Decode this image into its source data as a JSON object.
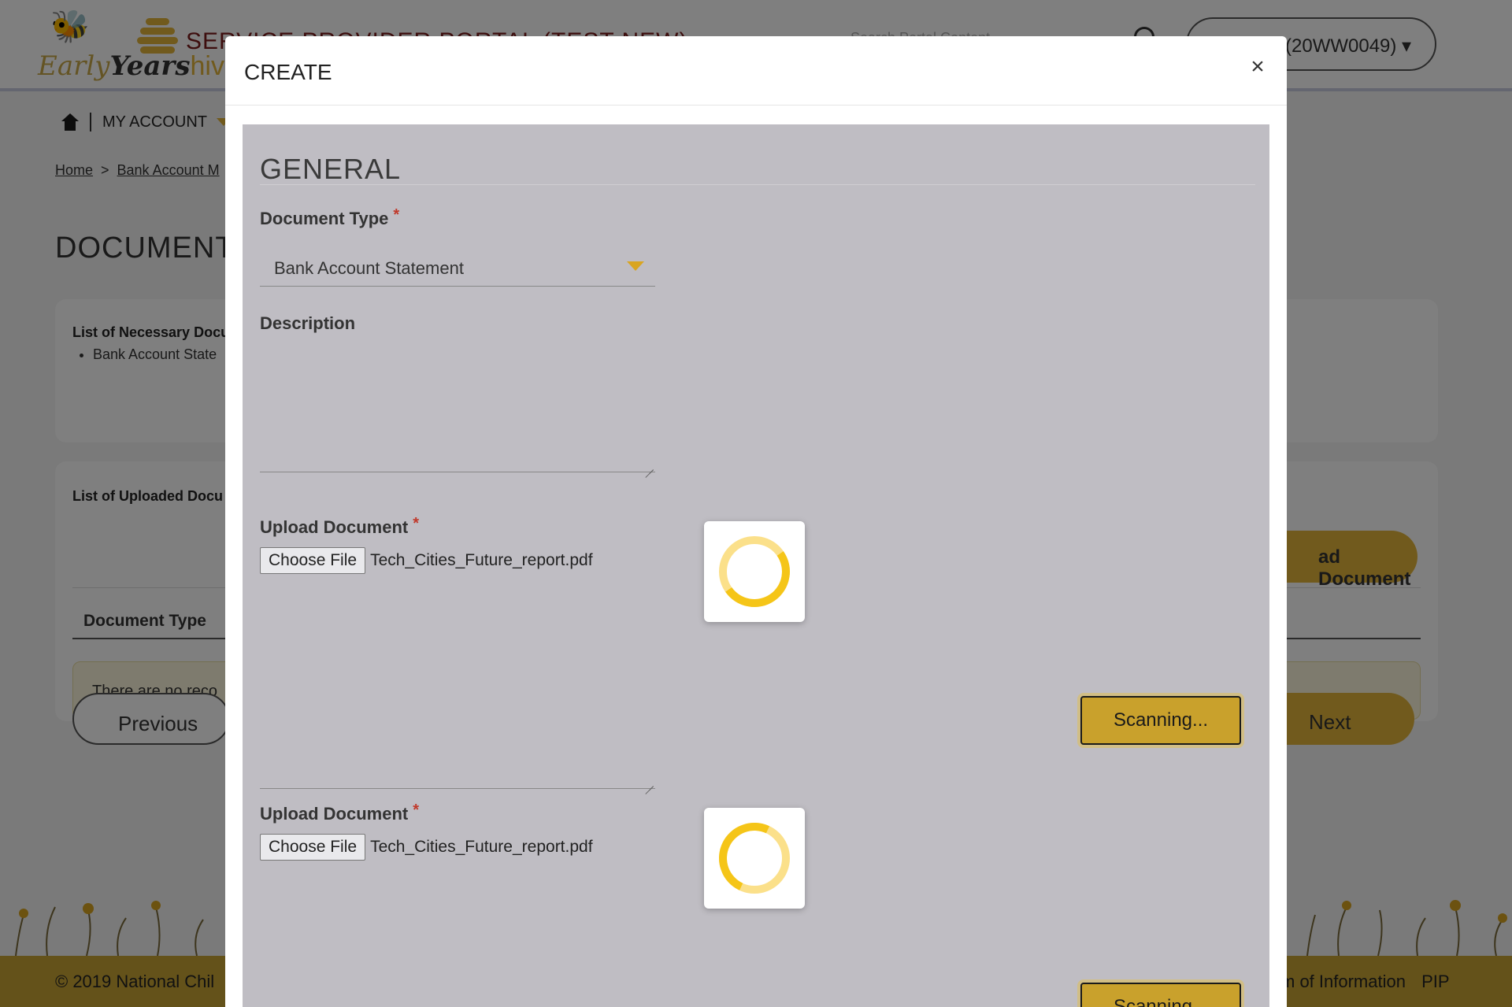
{
  "header": {
    "logo_text": [
      "Early",
      "Years",
      "hive"
    ],
    "portal_title": "SERVICE PROVIDER PORTAL (TEST NEW)",
    "search_placeholder": "Search Portal Content",
    "account_label": "(20WW0049)"
  },
  "nav": {
    "my_account": "MY ACCOUNT"
  },
  "breadcrumb": {
    "home": "Home",
    "separator": ">",
    "current": "Bank Account M"
  },
  "page": {
    "title": "DOCUMENT",
    "necessary_title": "List of Necessary Docu",
    "necessary_items": [
      "Bank Account State"
    ],
    "uploaded_title": "List of Uploaded Docu",
    "add_document": "ad Document",
    "col_document_type": "Document Type",
    "no_records": "There are no reco",
    "previous": "Previous",
    "next": "Next"
  },
  "footer": {
    "copyright": "© 2019 National Chil",
    "links": [
      "m of Information",
      "PIP"
    ]
  },
  "modal": {
    "title": "CREATE",
    "close": "×",
    "section_title": "GENERAL",
    "document_type_label": "Document Type",
    "document_type_value": "Bank Account Statement",
    "description_label": "Description",
    "required_mark": "*",
    "uploads": [
      {
        "label": "Upload Document",
        "button": "Choose File",
        "file_name": "Tech_Cities_Future_report.pdf",
        "scan_label": "Scanning..."
      },
      {
        "label": "Upload Document",
        "button": "Choose File",
        "file_name": "Tech_Cities_Future_report.pdf",
        "scan_label": "Scanning..."
      }
    ]
  },
  "colors": {
    "accent": "#e2b43a",
    "scan_button": "#c9a12c",
    "modal_body": "#bfbdc3",
    "required": "#c0392b",
    "spinner_track": "#fbe08a",
    "spinner_arc": "#f5c518"
  },
  "icons": {
    "home": "home-icon",
    "search": "search-icon",
    "close": "close-icon",
    "dropdown": "chevron-down-icon",
    "spinner": "loading-spinner-icon"
  }
}
